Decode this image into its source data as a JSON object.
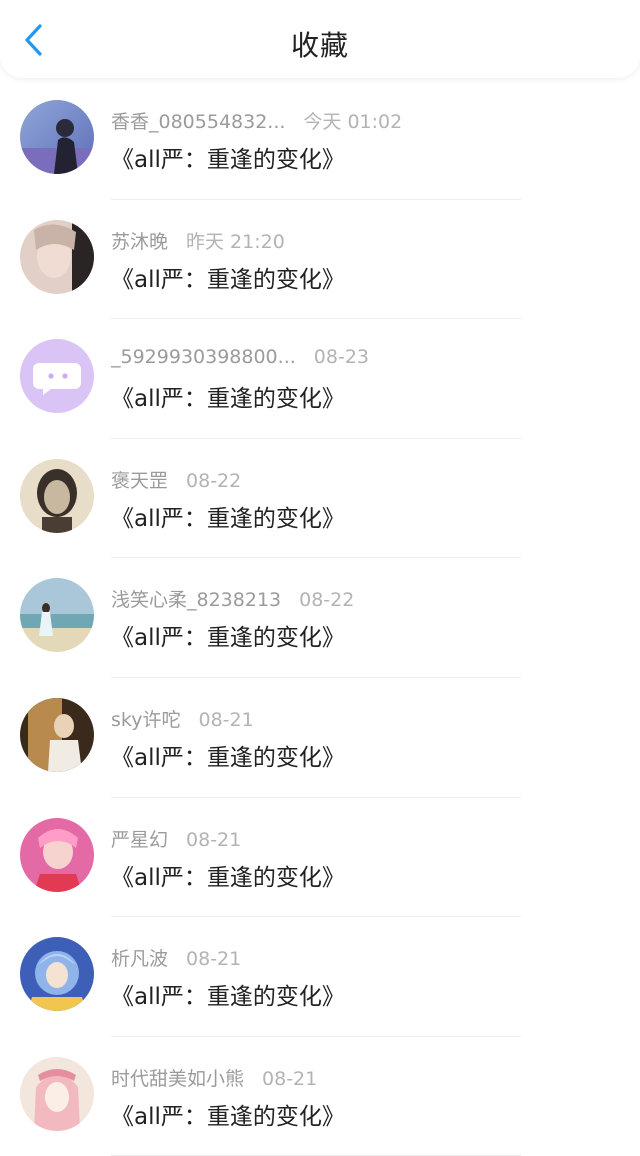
{
  "header": {
    "title": "收藏"
  },
  "colors": {
    "accent": "#2196f3"
  },
  "items": [
    {
      "name": "香香_080554832...",
      "time": "今天 01:02",
      "content": "《all严：重逢的变化》"
    },
    {
      "name": "苏沐晚",
      "time": "昨天 21:20",
      "content": "《all严：重逢的变化》"
    },
    {
      "name": "_5929930398800...",
      "time": "08-23",
      "content": "《all严：重逢的变化》"
    },
    {
      "name": "褒天罡",
      "time": "08-22",
      "content": "《all严：重逢的变化》"
    },
    {
      "name": "浅笑心柔_8238213",
      "time": "08-22",
      "content": "《all严：重逢的变化》"
    },
    {
      "name": "sky许咜",
      "time": "08-21",
      "content": "《all严：重逢的变化》"
    },
    {
      "name": "严星幻",
      "time": "08-21",
      "content": "《all严：重逢的变化》"
    },
    {
      "name": "析凡波",
      "time": "08-21",
      "content": "《all严：重逢的变化》"
    },
    {
      "name": "时代甜美如小熊",
      "time": "08-21",
      "content": "《all严：重逢的变化》"
    }
  ]
}
